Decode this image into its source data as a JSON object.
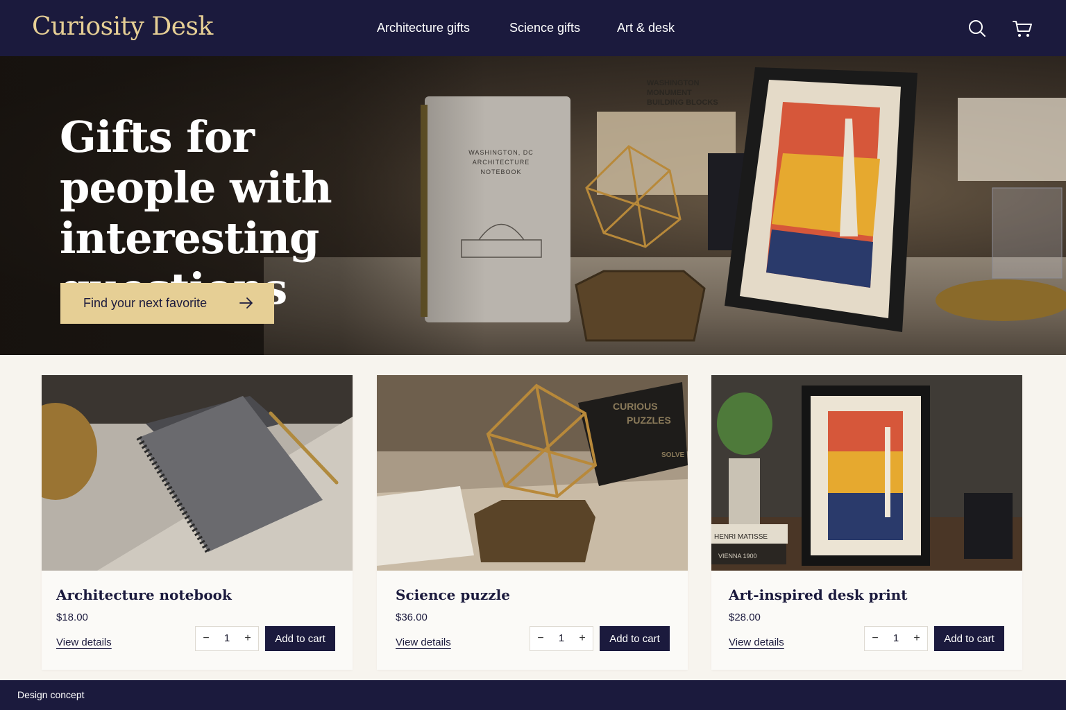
{
  "brand": {
    "name": "Curiosity Desk"
  },
  "nav": {
    "items": [
      "Architecture gifts",
      "Science gifts",
      "Art & desk"
    ]
  },
  "header_icons": {
    "search": "search-icon",
    "cart": "cart-icon"
  },
  "hero": {
    "title": "Gifts for people with interesting questions",
    "cta_label": "Find your next favorite",
    "notebook_cover": [
      "WASHINGTON, DC",
      "ARCHITECTURE",
      "NOTEBOOK"
    ],
    "sign_text": [
      "WASHINGTON",
      "MONUMENT",
      "BUILDING BLOCKS"
    ]
  },
  "products": [
    {
      "title": "Architecture notebook",
      "price": "$18.00",
      "link": "View details",
      "qty": "1",
      "add_label": "Add to cart"
    },
    {
      "title": "Science puzzle",
      "price": "$36.00",
      "link": "View details",
      "qty": "1",
      "add_label": "Add to cart",
      "box_text": [
        "CURIOUS",
        "PUZZLES",
        "SOLVE"
      ]
    },
    {
      "title": "Art-inspired desk print",
      "price": "$28.00",
      "link": "View details",
      "qty": "1",
      "add_label": "Add to cart",
      "book_text": [
        "HENRI MATISSE",
        "VIENNA 1900"
      ]
    }
  ],
  "stepper": {
    "minus": "−",
    "plus": "+"
  },
  "footer": {
    "label": "Design concept"
  },
  "colors": {
    "navy": "#1b1a3d",
    "gold": "#e6cf95",
    "page": "#f7f4ee",
    "card": "#fbfaf7"
  }
}
